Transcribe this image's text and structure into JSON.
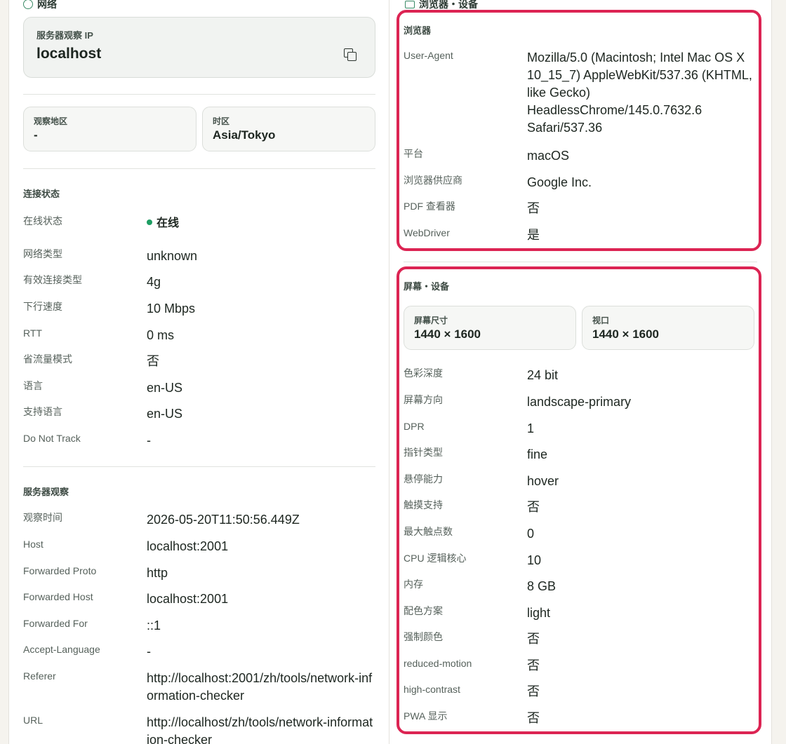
{
  "left": {
    "section_title": "网络",
    "hero": {
      "label": "服务器观察 IP",
      "value": "localhost"
    },
    "chips": [
      {
        "label": "观察地区",
        "value": "-"
      },
      {
        "label": "时区",
        "value": "Asia/Tokyo"
      }
    ],
    "connection": {
      "title": "连接状态",
      "rows": [
        {
          "k": "在线状态",
          "v": "在线"
        },
        {
          "k": "网络类型",
          "v": "unknown"
        },
        {
          "k": "有效连接类型",
          "v": "4g"
        },
        {
          "k": "下行速度",
          "v": "10 Mbps"
        },
        {
          "k": "RTT",
          "v": "0 ms"
        },
        {
          "k": "省流量模式",
          "v": "否"
        },
        {
          "k": "语言",
          "v": "en-US"
        },
        {
          "k": "支持语言",
          "v": "en-US"
        },
        {
          "k": "Do Not Track",
          "v": "-"
        }
      ]
    },
    "server": {
      "title": "服务器观察",
      "rows": [
        {
          "k": "观察时间",
          "v": "2026-05-20T11:50:56.449Z"
        },
        {
          "k": "Host",
          "v": "localhost:2001"
        },
        {
          "k": "Forwarded Proto",
          "v": "http"
        },
        {
          "k": "Forwarded Host",
          "v": "localhost:2001"
        },
        {
          "k": "Forwarded For",
          "v": "::1"
        },
        {
          "k": "Accept-Language",
          "v": "-"
        },
        {
          "k": "Referer",
          "v": "http://localhost:2001/zh/tools/network-information-checker"
        },
        {
          "k": "URL",
          "v": "http://localhost/zh/tools/network-information-checker"
        }
      ]
    }
  },
  "right": {
    "section_title": "浏览器・设备",
    "browser": {
      "title": "浏览器",
      "rows": [
        {
          "k": "User-Agent",
          "v": "Mozilla/5.0 (Macintosh; Intel Mac OS X 10_15_7) AppleWebKit/537.36 (KHTML, like Gecko) HeadlessChrome/145.0.7632.6 Safari/537.36"
        },
        {
          "k": "平台",
          "v": "macOS"
        },
        {
          "k": "浏览器供应商",
          "v": "Google Inc."
        },
        {
          "k": "PDF 查看器",
          "v": "否"
        },
        {
          "k": "WebDriver",
          "v": "是"
        }
      ]
    },
    "screen": {
      "title": "屏幕・设备",
      "chips": [
        {
          "label": "屏幕尺寸",
          "value": "1440 × 1600"
        },
        {
          "label": "视口",
          "value": "1440 × 1600"
        }
      ],
      "rows": [
        {
          "k": "色彩深度",
          "v": "24 bit"
        },
        {
          "k": "屏幕方向",
          "v": "landscape-primary"
        },
        {
          "k": "DPR",
          "v": "1"
        },
        {
          "k": "指针类型",
          "v": "fine"
        },
        {
          "k": "悬停能力",
          "v": "hover"
        },
        {
          "k": "触摸支持",
          "v": "否"
        },
        {
          "k": "最大触点数",
          "v": "0"
        },
        {
          "k": "CPU 逻辑核心",
          "v": "10"
        },
        {
          "k": "内存",
          "v": "8 GB"
        },
        {
          "k": "配色方案",
          "v": "light"
        },
        {
          "k": "强制颜色",
          "v": "否"
        },
        {
          "k": "reduced-motion",
          "v": "否"
        },
        {
          "k": "high-contrast",
          "v": "否"
        },
        {
          "k": "PWA 显示",
          "v": "否"
        }
      ]
    }
  },
  "colors": {
    "accent": "#3a8a66",
    "online": "#1e9e63",
    "highlight": "#dc2453"
  }
}
